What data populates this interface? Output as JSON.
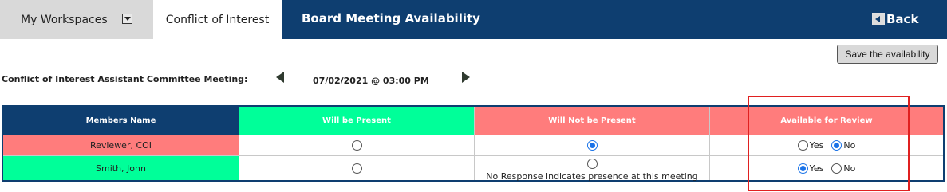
{
  "nav": {
    "workspaces_label": "My Workspaces",
    "coi_tab_label": "Conflict of Interest",
    "title": "Board Meeting Availability",
    "back_label": "Back"
  },
  "toolbar": {
    "save_label": "Save the availability"
  },
  "meeting": {
    "label": "Conflict of Interest Assistant Committee Meeting:",
    "datetime": "07/02/2021 @ 03:00 PM"
  },
  "table": {
    "headers": [
      "Members Name",
      "Will be Present",
      "Will Not be Present",
      "Available for Review"
    ],
    "rows": [
      {
        "name": "Reviewer, COI",
        "present": false,
        "not_present": true,
        "note": "",
        "available_yes": false,
        "available_no": true
      },
      {
        "name": "Smith, John",
        "present": false,
        "not_present": false,
        "note": "No Response indicates presence at this meeting",
        "available_yes": true,
        "available_no": false
      }
    ],
    "yes_label": "Yes",
    "no_label": "No"
  },
  "colors": {
    "nav_bg": "#0e3e70",
    "present_green": "#00ff99",
    "absent_red": "#ff7c7c",
    "highlight": "#e02020"
  }
}
